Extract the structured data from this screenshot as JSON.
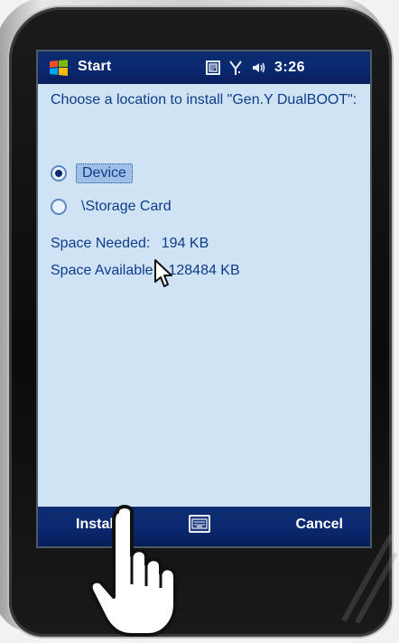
{
  "status_bar": {
    "start_label": "Start",
    "time": "3:26",
    "icons": [
      "windows-logo-icon",
      "notification-icon",
      "signal-icon",
      "speaker-icon"
    ]
  },
  "installer": {
    "prompt": "Choose a location to install \"Gen.Y DualBOOT\":",
    "options": [
      {
        "label": "Device",
        "selected": true
      },
      {
        "label": "\\Storage Card",
        "selected": false
      }
    ],
    "space_needed_label": "Space Needed:",
    "space_needed_value": "194 KB",
    "space_available_label": "Space Available:",
    "space_available_value": "128484 KB"
  },
  "softkeys": {
    "left": "Install",
    "right": "Cancel",
    "center_icon": "keyboard-icon"
  },
  "colors": {
    "titlebar": "#0a2a72",
    "screen_bg": "#cfe3f4",
    "text": "#0e3b8a"
  }
}
